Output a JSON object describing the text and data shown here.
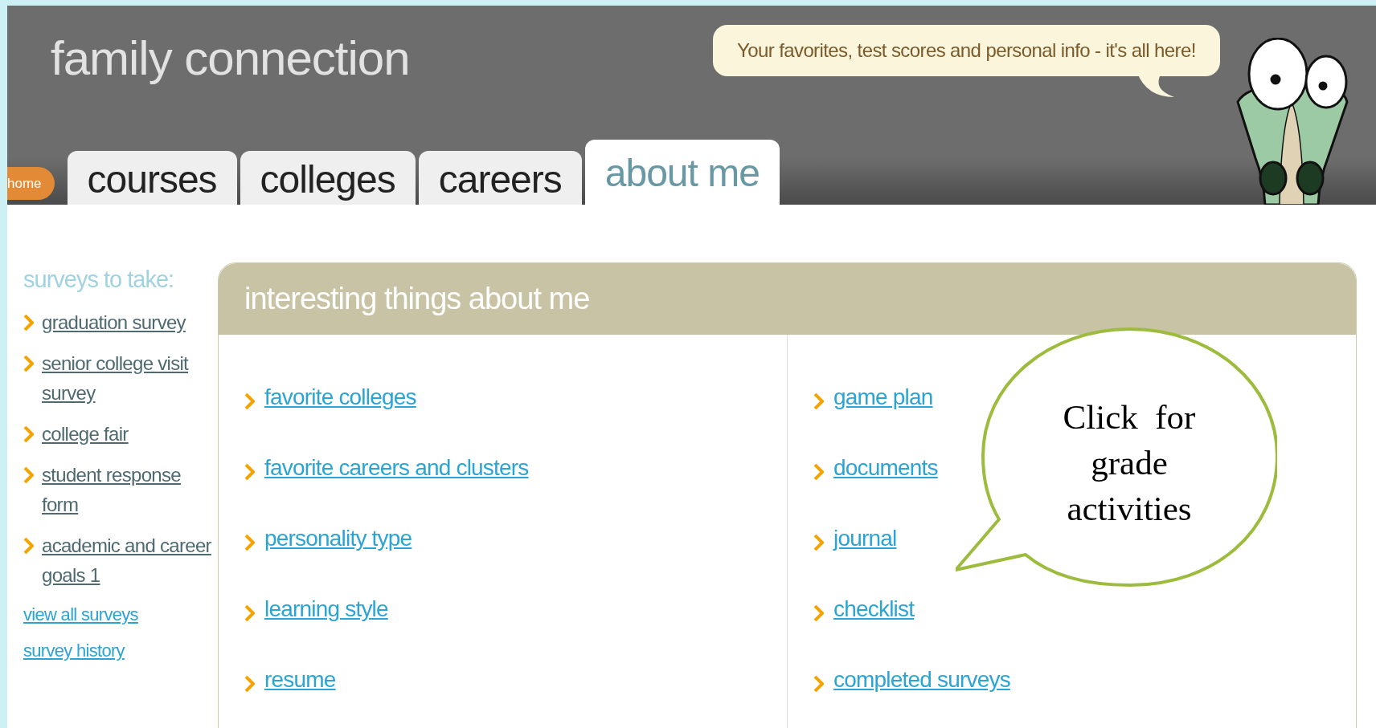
{
  "header": {
    "title": "family connection",
    "speech": "Your favorites, test scores and personal info - it's all here!"
  },
  "nav": {
    "home": "home",
    "tabs": [
      {
        "label": "courses",
        "selected": false
      },
      {
        "label": "colleges",
        "selected": false
      },
      {
        "label": "careers",
        "selected": false
      },
      {
        "label": "about me",
        "selected": true
      }
    ]
  },
  "sidebar": {
    "heading": "surveys to take:",
    "surveys": [
      "graduation survey",
      "senior college visit survey",
      "college fair",
      "student response form",
      "academic and career goals 1"
    ],
    "links": [
      "view all surveys",
      "survey history"
    ]
  },
  "panel": {
    "title": "interesting things about me",
    "columns": [
      [
        "favorite colleges",
        "favorite careers and clusters",
        "personality type",
        "learning style",
        "resume"
      ],
      [
        "game plan",
        "documents",
        "journal",
        "checklist",
        "completed surveys"
      ]
    ]
  },
  "callout": {
    "text": "Click  for grade activities"
  }
}
